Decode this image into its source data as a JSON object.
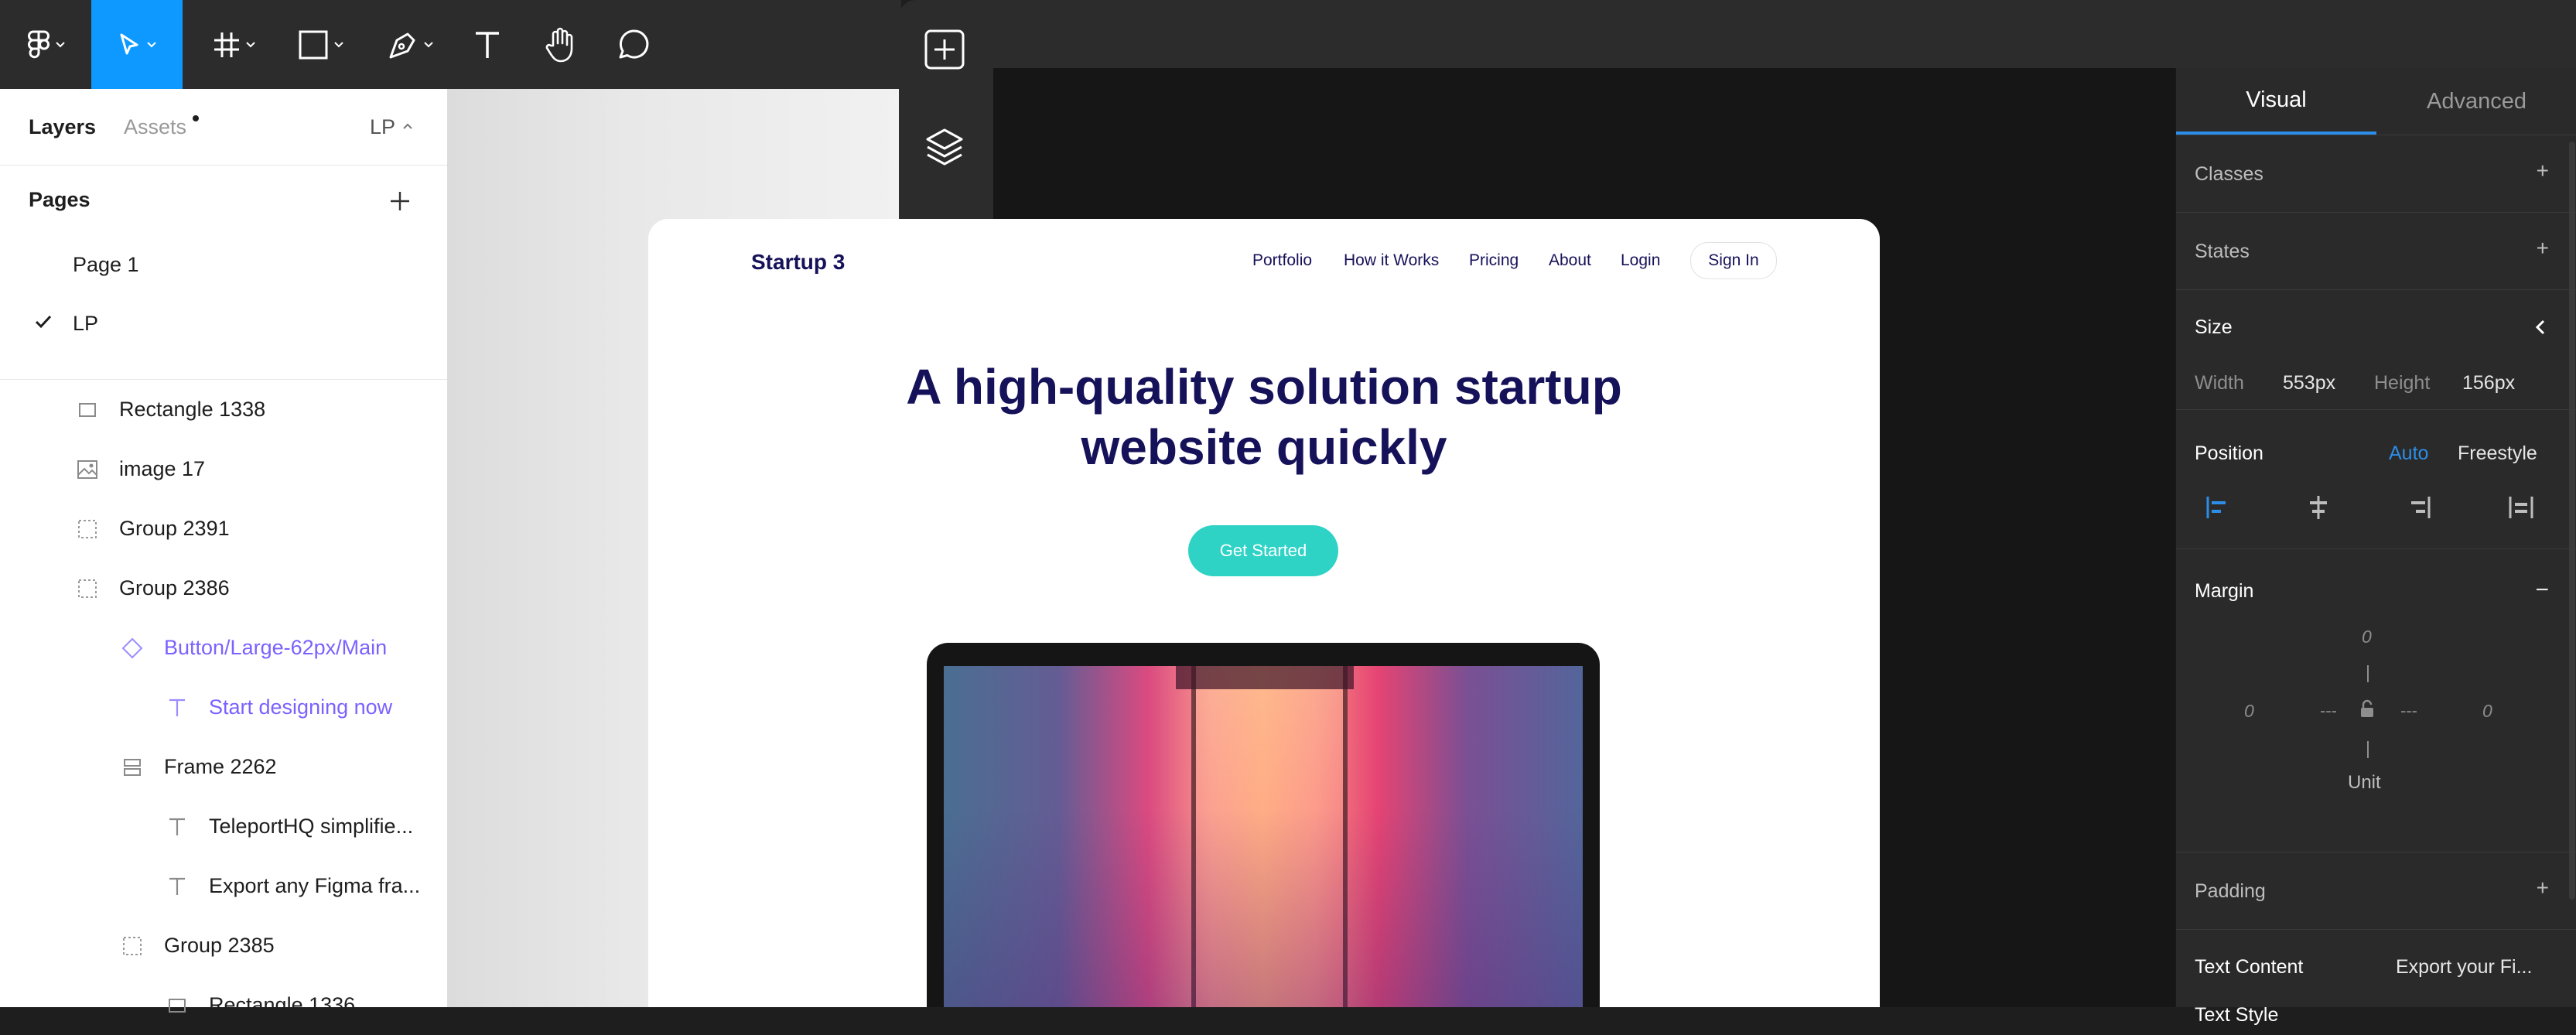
{
  "figma": {
    "toolbar": {
      "tools": [
        "figma-menu",
        "move",
        "frame",
        "shape",
        "pen",
        "text",
        "hand",
        "comment"
      ]
    },
    "left_panel": {
      "tabs": [
        {
          "label": "Layers",
          "active": true
        },
        {
          "label": "Assets",
          "active": false
        }
      ],
      "page_selector": "LP",
      "pages_header": "Pages",
      "pages": [
        {
          "label": "Page 1",
          "selected": false
        },
        {
          "label": "LP",
          "selected": true
        }
      ],
      "layers": [
        {
          "label": "Rectangle 1338",
          "icon": "rectangle-icon"
        },
        {
          "label": "image 17",
          "icon": "image-icon"
        },
        {
          "label": "Group 2391",
          "icon": "group-icon"
        },
        {
          "label": "Group 2386",
          "icon": "group-icon"
        },
        {
          "label": "Button/Large-62px/Main",
          "icon": "component-instance-icon"
        },
        {
          "label": "Start designing now",
          "icon": "text-icon"
        },
        {
          "label": "Frame 2262",
          "icon": "auto-layout-icon"
        },
        {
          "label": "TeleportHQ simplifie...",
          "icon": "text-icon"
        },
        {
          "label": "Export any Figma fra...",
          "icon": "text-icon"
        },
        {
          "label": "Group 2385",
          "icon": "group-icon"
        },
        {
          "label": "Rectangle 1336",
          "icon": "rectangle-icon"
        }
      ]
    }
  },
  "teleport": {
    "sidebar_icons": [
      "add-icon",
      "layers-icon"
    ]
  },
  "website": {
    "logo": "Startup 3",
    "nav": [
      "Portfolio",
      "How it Works",
      "Pricing",
      "About",
      "Login"
    ],
    "signin": "Sign In",
    "headline_line1": "A high-quality solution startup",
    "headline_line2": "website quickly",
    "cta": "Get Started"
  },
  "properties": {
    "tabs": [
      {
        "label": "Visual",
        "active": true
      },
      {
        "label": "Advanced",
        "active": false
      }
    ],
    "classes": "Classes",
    "states": "States",
    "size": {
      "title": "Size",
      "width_label": "Width",
      "width_value": "553px",
      "height_label": "Height",
      "height_value": "156px"
    },
    "position": {
      "title": "Position",
      "auto": "Auto",
      "freestyle": "Freestyle"
    },
    "margin": {
      "title": "Margin",
      "top": "0",
      "left": "0",
      "right": "0",
      "dash_left": "---",
      "dash_right": "---",
      "unit": "Unit"
    },
    "padding": "Padding",
    "text_content": {
      "label": "Text Content",
      "value": "Export your Fi..."
    },
    "text_style": "Text Style"
  },
  "colors": {
    "figma_accent": "#0d99ff",
    "teleport_accent": "#2c8ee8",
    "brand_navy": "#16125a",
    "cta_teal": "#2ed3c6",
    "component_purple": "#7b61ff"
  }
}
